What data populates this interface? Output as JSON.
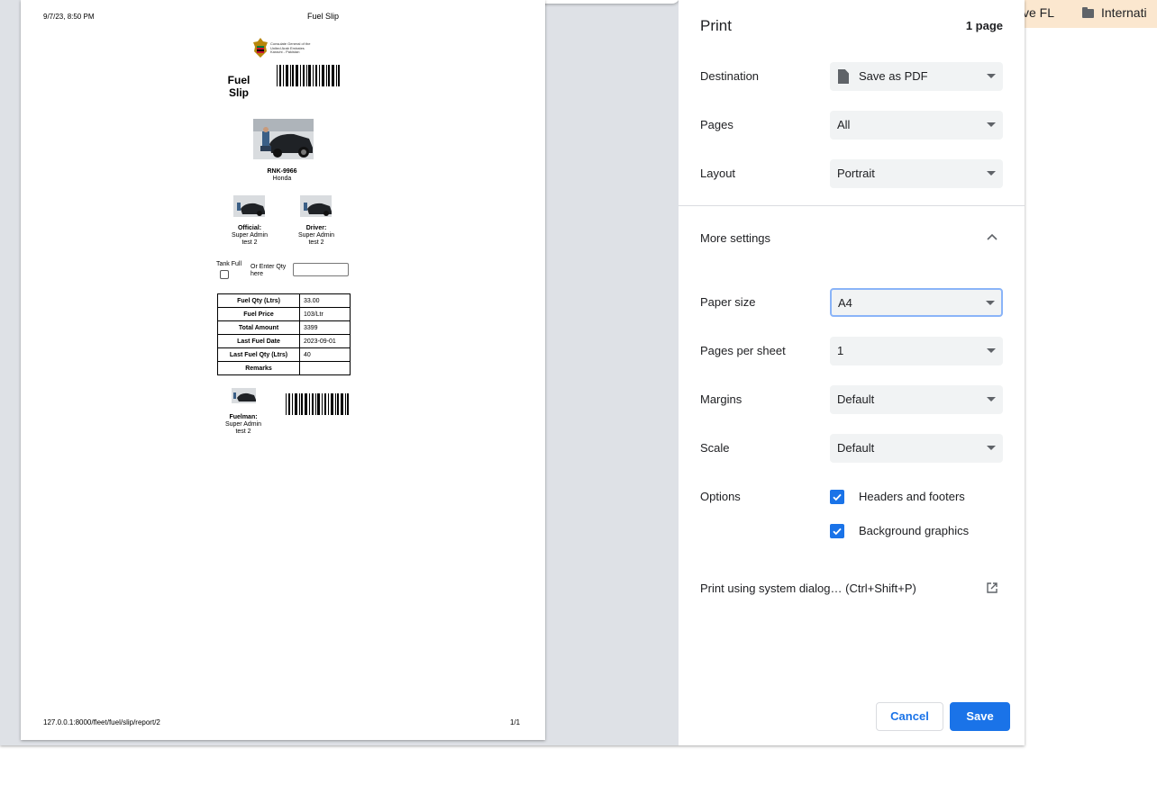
{
  "bookmarks": {
    "item1": "ctive FL",
    "item2": "Internati"
  },
  "preview": {
    "header_date": "9/7/23, 8:50 PM",
    "header_title": "Fuel Slip",
    "footer_url": "127.0.0.1:8000/fleet/fuel/slip/report/2",
    "footer_page": "1/1",
    "logo_text": [
      "Consulate General of the",
      "United Arab Emirates",
      "Karachi - Pakistan"
    ],
    "slip_title_line1": "Fuel",
    "slip_title_line2": "Slip",
    "plate": "RNK-9966",
    "make": "Honda",
    "official_role": "Official:",
    "official_name": "Super Admin",
    "official_sub": "test 2",
    "driver_role": "Driver:",
    "driver_name": "Super Admin",
    "driver_sub": "test 2",
    "fuelman_role": "Fuelman:",
    "fuelman_name": "Super Admin",
    "fuelman_sub": "test 2",
    "tank_full_label": "Tank Full",
    "qty_label_line1": "Or Enter Qty",
    "qty_label_line2": "here",
    "table": [
      {
        "key": "Fuel Qty (Ltrs)",
        "value": "33.00"
      },
      {
        "key": "Fuel Price",
        "value": "103/Ltr"
      },
      {
        "key": "Total Amount",
        "value": "3399"
      },
      {
        "key": "Last Fuel Date",
        "value": "2023-09-01"
      },
      {
        "key": "Last Fuel Qty (Ltrs)",
        "value": "40"
      },
      {
        "key": "Remarks",
        "value": ""
      }
    ]
  },
  "settings": {
    "title": "Print",
    "page_count": "1 page",
    "destination_label": "Destination",
    "destination_value": "Save as PDF",
    "pages_label": "Pages",
    "pages_value": "All",
    "layout_label": "Layout",
    "layout_value": "Portrait",
    "more_settings_label": "More settings",
    "paper_size_label": "Paper size",
    "paper_size_value": "A4",
    "pages_per_sheet_label": "Pages per sheet",
    "pages_per_sheet_value": "1",
    "margins_label": "Margins",
    "margins_value": "Default",
    "scale_label": "Scale",
    "scale_value": "Default",
    "options_label": "Options",
    "headers_footers_label": "Headers and footers",
    "headers_footers_checked": true,
    "background_graphics_label": "Background graphics",
    "background_graphics_checked": true,
    "system_dialog_label": "Print using system dialog… (Ctrl+Shift+P)",
    "cancel_label": "Cancel",
    "save_label": "Save"
  },
  "colors": {
    "accent": "#1a73e8",
    "preview_bg": "#dee1e6",
    "select_bg": "#f1f3f4",
    "bookmark_bar": "#fbe7cf"
  }
}
